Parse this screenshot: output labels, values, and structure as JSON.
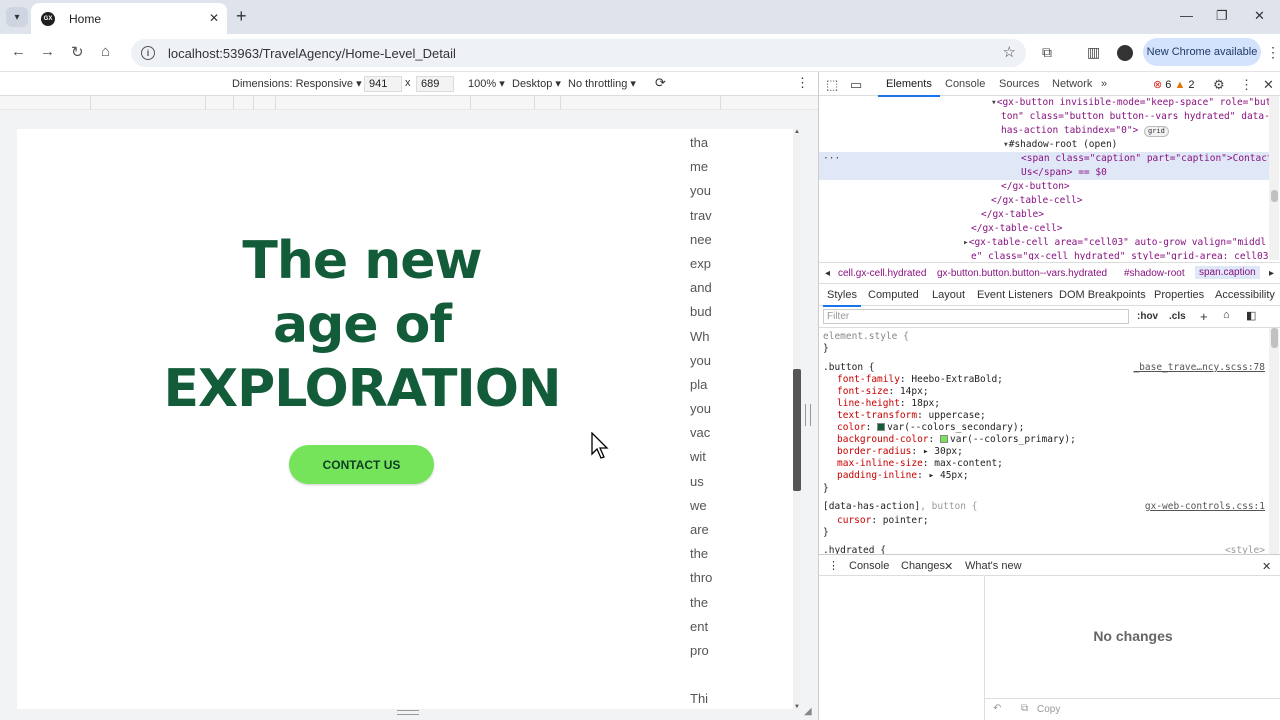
{
  "browser": {
    "tab_title": "Home",
    "tab_favicon": "GX",
    "url": "localhost:53963/TravelAgency/Home-Level_Detail",
    "update_label": "New Chrome available"
  },
  "device_toolbar": {
    "dimensions_label": "Dimensions: Responsive",
    "width": "941",
    "times": "x",
    "height": "689",
    "zoom": "100%",
    "device": "Desktop",
    "throttling": "No throttling"
  },
  "page": {
    "hero_lines": [
      "The new",
      "age of",
      "EXPLORATION"
    ],
    "contact_label": "CONTACT US",
    "side_words": [
      "tha",
      "me",
      "you",
      "trav",
      "nee",
      "exp",
      "and",
      "bud",
      "Wh",
      "you",
      "pla",
      "you",
      "vac",
      "wit",
      "us",
      "we",
      "are",
      "the",
      "thro",
      "the",
      "ent",
      "pro",
      "",
      "Thi"
    ],
    "colors": {
      "title": "#135c3a",
      "button_bg": "#75e45a",
      "button_text": "#0f3d24"
    }
  },
  "devtools": {
    "tabs": [
      "Elements",
      "Console",
      "Sources",
      "Network"
    ],
    "errors": "6",
    "warnings": "2",
    "dom_lines": [
      "<gx-button invisible-mode=\"keep-space\" role=\"but",
      "ton\" class=\"button button--vars hydrated\" data-",
      "has-action tabindex=\"0\">",
      "#shadow-root (open)",
      "<span class=\"caption\" part=\"caption\">Contact",
      "Us</span> == $0",
      "</gx-button>",
      "</gx-table-cell>",
      "</gx-table>",
      "</gx-table-cell>",
      "<gx-table-cell area=\"cell03\" auto-grow valign=\"middl",
      "e\" class=\"gx-cell hydrated\" style=\"grid-area: cell03;"
    ],
    "grid_badge": "grid",
    "breadcrumbs": [
      "cell.gx-cell.hydrated",
      "gx-button.button.button--vars.hydrated",
      "#shadow-root",
      "span.caption"
    ],
    "style_tabs": [
      "Styles",
      "Computed",
      "Layout",
      "Event Listeners",
      "DOM Breakpoints",
      "Properties",
      "Accessibility"
    ],
    "filter_placeholder": "Filter",
    "hov": ":hov",
    "cls": ".cls",
    "styles": {
      "element_style": "element.style {",
      "close": "}",
      "button_selector": ".button {",
      "button_source": "_base_trave…ncy.scss:78",
      "props": [
        {
          "name": "font-family",
          "value": "Heebo-ExtraBold;"
        },
        {
          "name": "font-size",
          "value": "14px;"
        },
        {
          "name": "line-height",
          "value": "18px;"
        },
        {
          "name": "text-transform",
          "value": "uppercase;"
        },
        {
          "name": "color",
          "value": "var(--colors_secondary);",
          "swatch": "#135c3a"
        },
        {
          "name": "background-color",
          "value": "var(--colors_primary);",
          "swatch": "#75e45a"
        },
        {
          "name": "border-radius",
          "value": "30px;",
          "arrow": true
        },
        {
          "name": "max-inline-size",
          "value": "max-content;"
        },
        {
          "name": "padding-inline",
          "value": "45px;",
          "arrow": true
        }
      ],
      "action_selector": "[data-has-action]",
      "action_selector2": ", button {",
      "action_source": "gx-web-controls.css:1",
      "cursor_prop": "cursor",
      "cursor_value": "pointer;",
      "hydrated_selector": ".hydrated {",
      "hydrated_source": "<style>"
    },
    "drawer_tabs": [
      "Console",
      "Changes",
      "What's new"
    ],
    "no_changes": "No changes",
    "copy_label": "Copy"
  }
}
